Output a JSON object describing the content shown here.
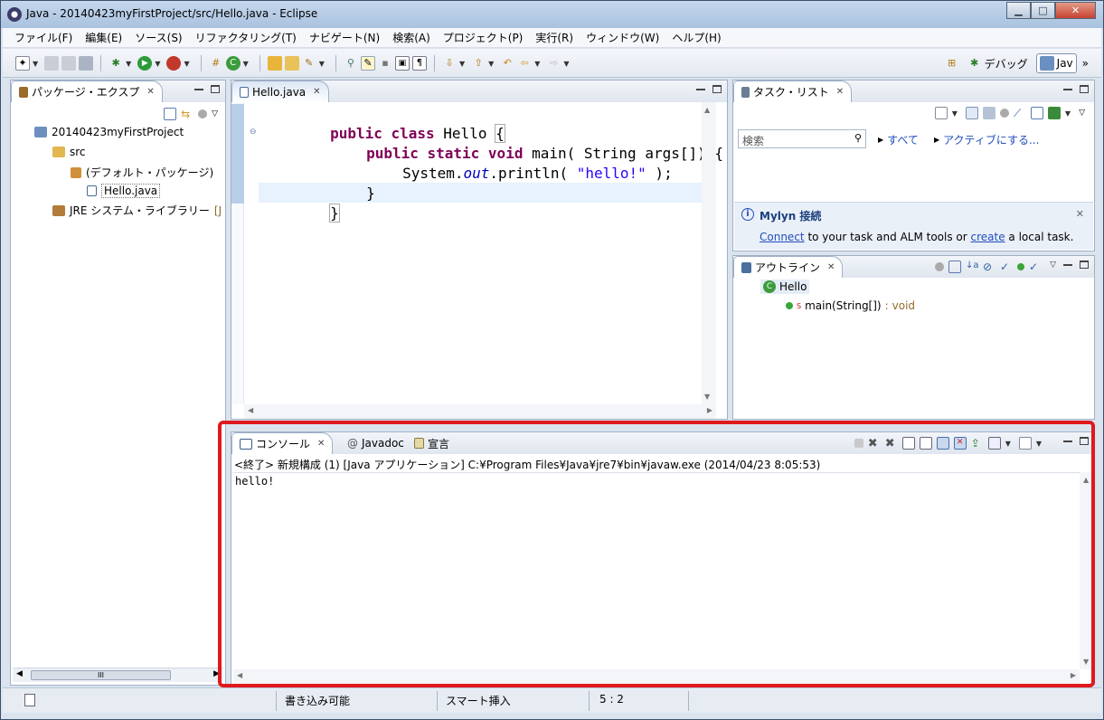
{
  "window": {
    "title": "Java - 20140423myFirstProject/src/Hello.java - Eclipse",
    "buttons": {
      "minimize": "▁",
      "maximize": "□",
      "close": "✕"
    }
  },
  "menu": [
    "ファイル(F)",
    "編集(E)",
    "ソース(S)",
    "リファクタリング(T)",
    "ナビゲート(N)",
    "検索(A)",
    "プロジェクト(P)",
    "実行(R)",
    "ウィンドウ(W)",
    "ヘルプ(H)"
  ],
  "perspectives": {
    "debug": "デバッグ",
    "java": "Jav",
    "more": "»"
  },
  "package_explorer": {
    "tab": "パッケージ・エクスプ",
    "tree": {
      "project": "20140423myFirstProject",
      "src": "src",
      "package": "(デフォルト・パッケージ)",
      "file": "Hello.java",
      "jre": "JRE システム・ライブラリー",
      "jre_suffix": "[J"
    },
    "scroll_label": "III"
  },
  "editor": {
    "tab": "Hello.java",
    "code": {
      "l1_kw": "public class",
      "l1_rest": " Hello ",
      "l1_brace": "{",
      "l2_kw": "public static void",
      "l2_rest": " main( String args[]) {",
      "l3_a": "System.",
      "l3_field": "out",
      "l3_b": ".println( ",
      "l3_str": "\"hello!\"",
      "l3_c": " );",
      "l4": "}",
      "l5": "}"
    }
  },
  "task_list": {
    "tab": "タスク・リスト",
    "search_placeholder": "検索",
    "all": "すべて",
    "activate": "アクティブにする...",
    "mylyn_title": "Mylyn 接続",
    "mylyn_connect": "Connect",
    "mylyn_mid": " to your task and ALM tools or ",
    "mylyn_create": "create",
    "mylyn_end": " a local task."
  },
  "outline": {
    "tab": "アウトライン",
    "class": "Hello",
    "method": "main(String[])",
    "method_sep": " : ",
    "return_type": "void",
    "static_mark": "S"
  },
  "console": {
    "tabs": [
      "コンソール",
      "Javadoc",
      "宣言"
    ],
    "header": "<終了> 新規構成 (1) [Java アプリケーション] C:¥Program Files¥Java¥jre7¥bin¥javaw.exe (2014/04/23 8:05:53)",
    "output": "hello!"
  },
  "status": {
    "writable": "書き込み可能",
    "insert_mode": "スマート挿入",
    "position": "5 : 2"
  },
  "colors": {
    "keyword": "#7f0055",
    "string": "#2a00ff",
    "field": "#0000c0",
    "highlight": "#e0191e"
  }
}
